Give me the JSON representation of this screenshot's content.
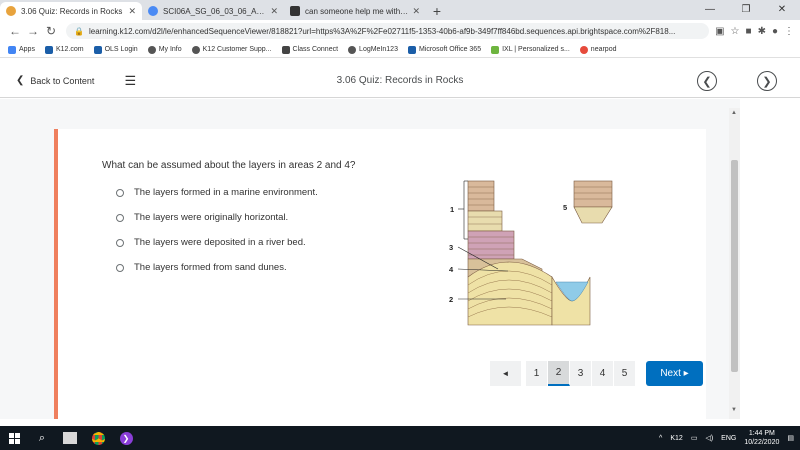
{
  "browser": {
    "tabs": [
      {
        "title": "3.06 Quiz: Records in Rocks",
        "color": "#e8a33d"
      },
      {
        "title": "SCI06A_SG_06_03_06_A11Y.pdf",
        "color": "#4a8af4"
      },
      {
        "title": "can someone help me with writi",
        "color": "#333333"
      }
    ],
    "new_tab": "+",
    "url": "learning.k12.com/d2l/le/enhancedSequenceViewer/818821?url=https%3A%2F%2Fe02711f5-1353-40b6-af9b-349f7ff846bd.sequences.api.brightspace.com%2F818...",
    "bookmarks": [
      {
        "label": "Apps",
        "color": "#4285f4"
      },
      {
        "label": "K12.com",
        "color": "#1b5ea8"
      },
      {
        "label": "OLS Login",
        "color": "#1b5ea8"
      },
      {
        "label": "My Info",
        "color": "#555555"
      },
      {
        "label": "K12 Customer Supp...",
        "color": "#555555"
      },
      {
        "label": "Class Connect",
        "color": "#444444"
      },
      {
        "label": "LogMeIn123",
        "color": "#555555"
      },
      {
        "label": "Microsoft Office 365",
        "color": "#1b5ea8"
      },
      {
        "label": "IXL | Personalized s...",
        "color": "#6eb53f"
      },
      {
        "label": "nearpod",
        "color": "#e64b3c"
      }
    ]
  },
  "d2l": {
    "back_label": "Back to Content",
    "title": "3.06 Quiz: Records in Rocks"
  },
  "quiz": {
    "question": "What can be assumed about the layers in areas 2 and 4?",
    "options": [
      "The layers formed in a marine environment.",
      "The layers were originally horizontal.",
      "The layers were deposited in a river bed.",
      "The layers formed from sand dunes."
    ],
    "figure_labels": [
      "1",
      "3",
      "4",
      "2",
      "5"
    ]
  },
  "pager": {
    "prev": "◄",
    "pages": [
      "1",
      "2",
      "3",
      "4",
      "5"
    ],
    "current_page": "2",
    "next_label": "Next ▸"
  },
  "taskbar": {
    "lang": "ENG",
    "time": "1:44 PM",
    "date": "10/22/2020",
    "k12": "K12"
  }
}
